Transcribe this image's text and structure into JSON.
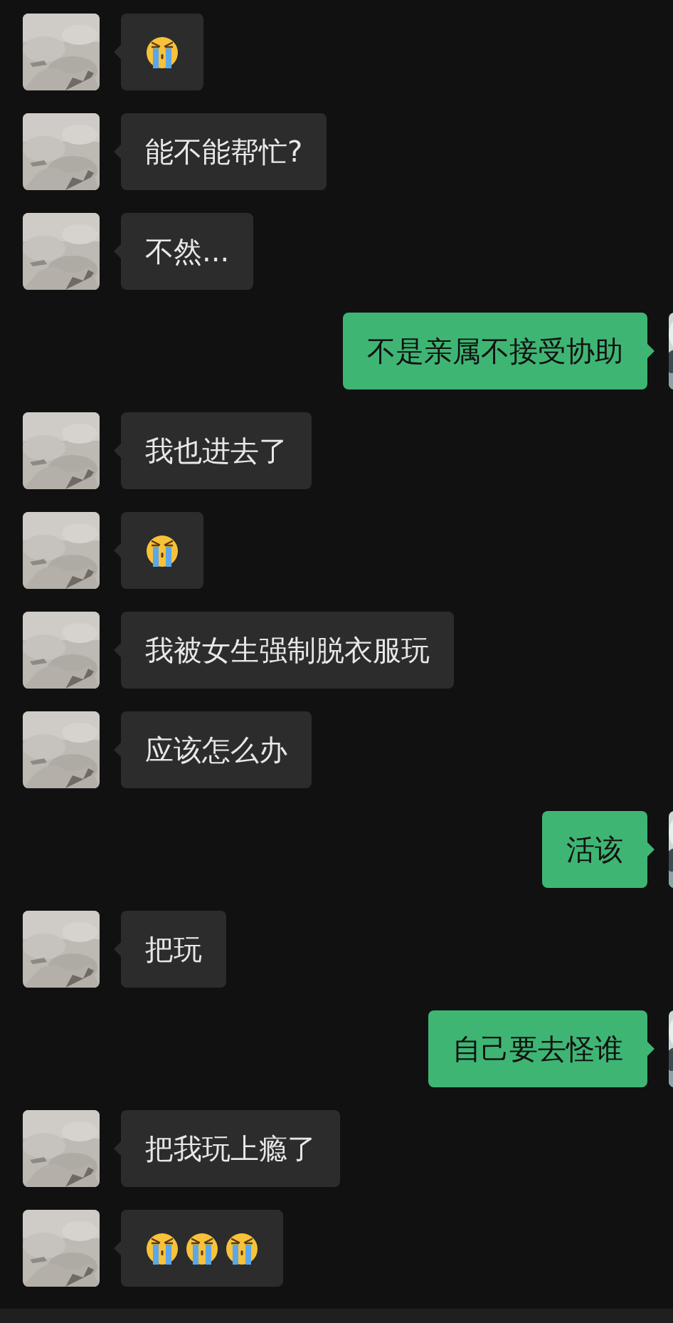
{
  "messages": [
    {
      "outgoing": false,
      "kind": "emoji",
      "emojis": [
        {
          "kind": "crying-face"
        }
      ]
    },
    {
      "outgoing": false,
      "kind": "text",
      "text": "能不能帮忙?"
    },
    {
      "outgoing": false,
      "kind": "text",
      "text": "不然..."
    },
    {
      "outgoing": true,
      "kind": "text",
      "text": "不是亲属不接受协助"
    },
    {
      "outgoing": false,
      "kind": "text",
      "text": "我也进去了"
    },
    {
      "outgoing": false,
      "kind": "emoji",
      "emojis": [
        {
          "kind": "crying-face"
        }
      ]
    },
    {
      "outgoing": false,
      "kind": "text",
      "text": "我被女生强制脱衣服玩"
    },
    {
      "outgoing": false,
      "kind": "text",
      "text": "应该怎么办"
    },
    {
      "outgoing": true,
      "kind": "text",
      "text": "活该"
    },
    {
      "outgoing": false,
      "kind": "text",
      "text": "把玩"
    },
    {
      "outgoing": true,
      "kind": "text",
      "text": "自己要去怪谁"
    },
    {
      "outgoing": false,
      "kind": "text",
      "text": "把我玩上瘾了"
    },
    {
      "outgoing": false,
      "kind": "emoji",
      "emojis": [
        {
          "kind": "crying-face"
        },
        {
          "kind": "crying-face"
        },
        {
          "kind": "crying-face"
        }
      ]
    }
  ]
}
